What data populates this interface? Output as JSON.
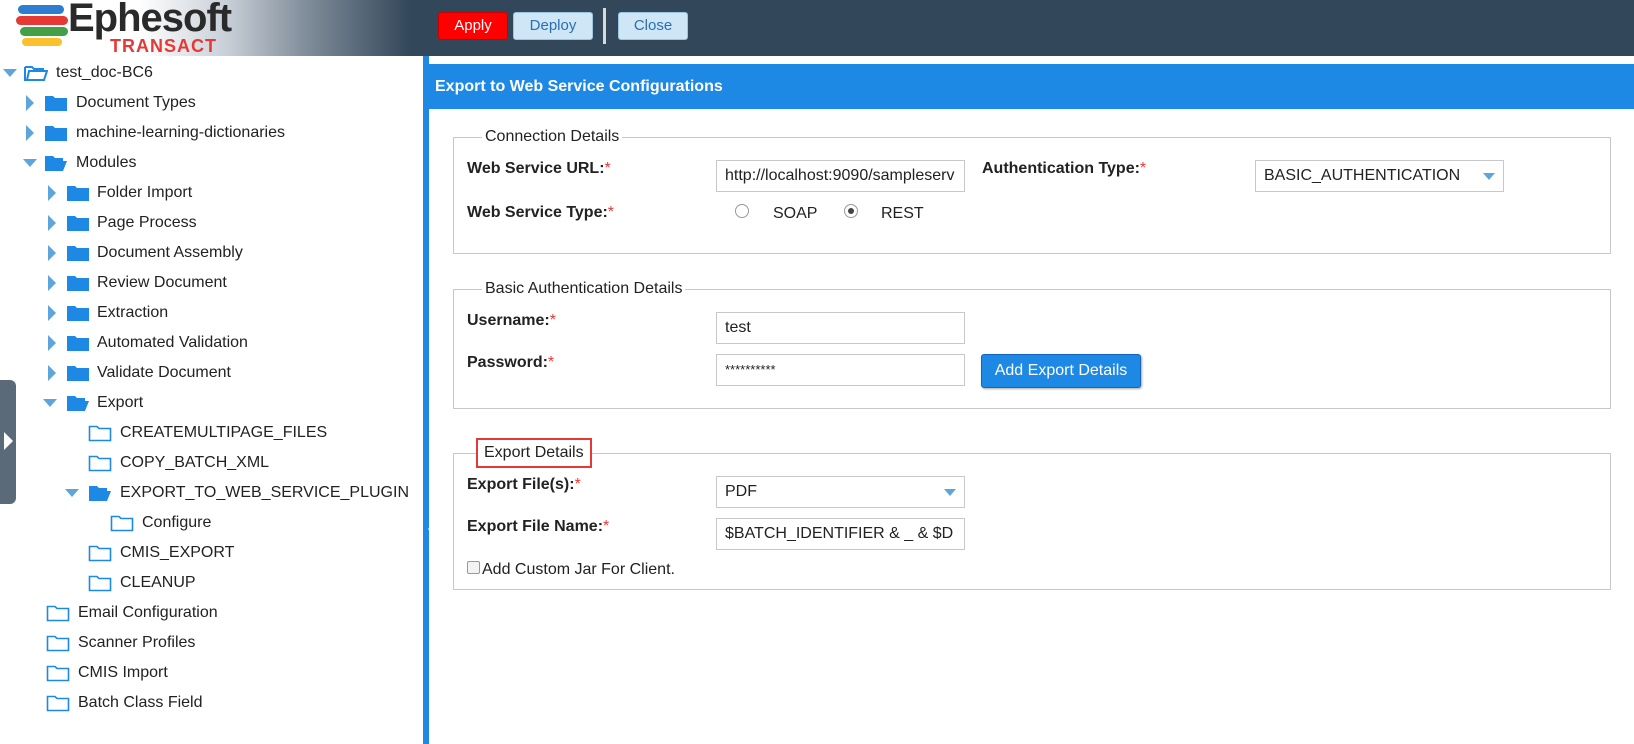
{
  "header": {
    "logo_text": "Ephesoft",
    "logo_sub": "TRANSACT",
    "apply_label": "Apply",
    "deploy_label": "Deploy",
    "close_label": "Close"
  },
  "tree": {
    "root": "test_doc-BC6",
    "document_types": "Document Types",
    "ml_dictionaries": "machine-learning-dictionaries",
    "modules": "Modules",
    "folder_import": "Folder Import",
    "page_process": "Page Process",
    "document_assembly": "Document Assembly",
    "review_document": "Review Document",
    "extraction": "Extraction",
    "automated_validation": "Automated Validation",
    "validate_document": "Validate Document",
    "export": "Export",
    "createmultipage_files": "CREATEMULTIPAGE_FILES",
    "copy_batch_xml": "COPY_BATCH_XML",
    "export_to_web_service_plugin": "EXPORT_TO_WEB_SERVICE_PLUGIN",
    "configure": "Configure",
    "cmis_export": "CMIS_EXPORT",
    "cleanup": "CLEANUP",
    "email_configuration": "Email Configuration",
    "scanner_profiles": "Scanner Profiles",
    "cmis_import": "CMIS Import",
    "batch_class_field": "Batch Class Field"
  },
  "content": {
    "title": "Export to Web Service Configurations",
    "connection": {
      "legend": "Connection Details",
      "url_label": "Web Service URL:",
      "url_value": "http://localhost:9090/sampleserv",
      "auth_type_label": "Authentication Type:",
      "auth_type_value": "BASIC_AUTHENTICATION",
      "ws_type_label": "Web Service Type:",
      "soap_label": "SOAP",
      "rest_label": "REST",
      "selected_type": "REST"
    },
    "basic_auth": {
      "legend": "Basic Authentication Details",
      "username_label": "Username:",
      "username_value": "test",
      "password_label": "Password:",
      "password_value": "**********",
      "add_button": "Add Export Details"
    },
    "export_details": {
      "legend": "Export Details",
      "files_label": "Export File(s):",
      "files_value": "PDF",
      "name_label": "Export File Name:",
      "name_value": "$BATCH_IDENTIFIER & _ & $D",
      "custom_jar_label": "Add Custom Jar For Client."
    },
    "required_mark": "*"
  },
  "colors": {
    "header_bg": "#33475b",
    "accent": "#1e88e5",
    "apply": "#ff0000",
    "folder": "#1e88e5",
    "highlight_box": "#e53935"
  }
}
